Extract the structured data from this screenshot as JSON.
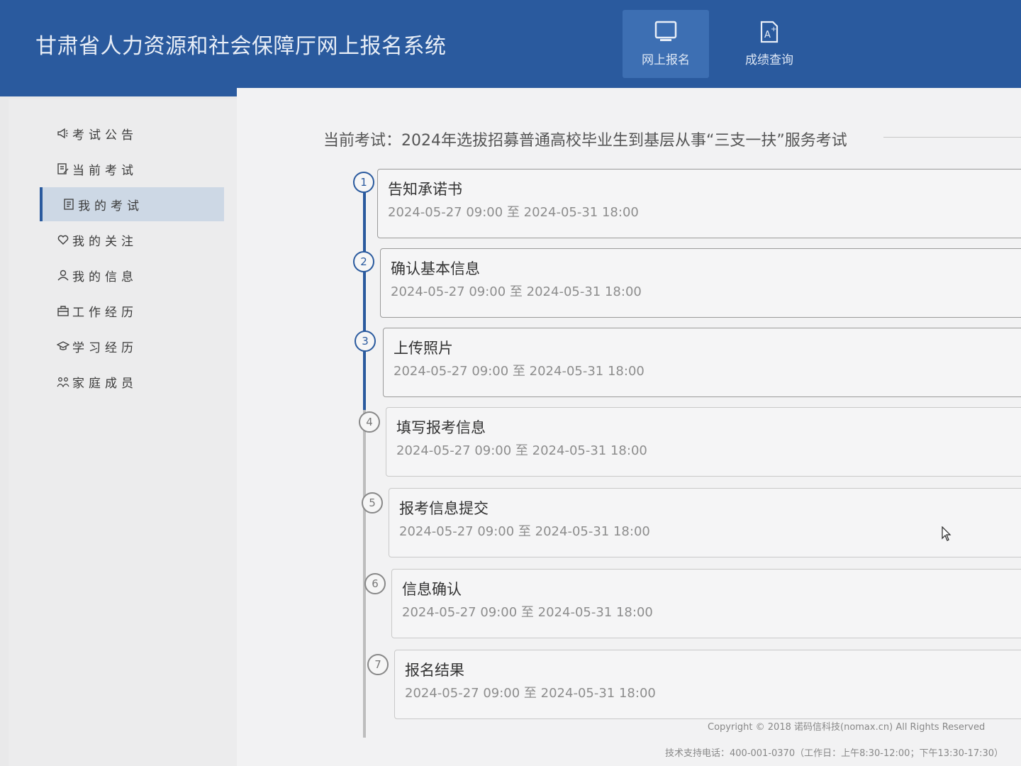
{
  "header": {
    "title": "甘肃省人力资源和社会保障厅网上报名系统",
    "nav": [
      {
        "label": "网上报名",
        "icon": "monitor-icon",
        "active": true
      },
      {
        "label": "成绩查询",
        "icon": "grade-doc-icon",
        "active": false
      }
    ]
  },
  "sidebar": {
    "items": [
      {
        "label": "考试公告",
        "icon": "megaphone-icon"
      },
      {
        "label": "当前考试",
        "icon": "edit-doc-icon"
      },
      {
        "label": "我的考试",
        "icon": "doc-list-icon",
        "active": true
      },
      {
        "label": "我的关注",
        "icon": "heart-icon"
      },
      {
        "label": "我的信息",
        "icon": "user-icon"
      },
      {
        "label": "工作经历",
        "icon": "briefcase-icon"
      },
      {
        "label": "学习经历",
        "icon": "graduation-cap-icon"
      },
      {
        "label": "家庭成员",
        "icon": "family-icon"
      }
    ]
  },
  "main": {
    "current_exam": "当前考试：2024年选拔招募普通高校毕业生到基层从事“三支一扶”服务考试",
    "steps": [
      {
        "num": "1",
        "name": "告知承诺书",
        "time": "2024-05-27 09:00 至 2024-05-31 18:00",
        "done": true
      },
      {
        "num": "2",
        "name": "确认基本信息",
        "time": "2024-05-27 09:00 至 2024-05-31 18:00",
        "done": true
      },
      {
        "num": "3",
        "name": "上传照片",
        "time": "2024-05-27 09:00 至 2024-05-31 18:00",
        "done": true
      },
      {
        "num": "4",
        "name": "填写报考信息",
        "time": "2024-05-27 09:00 至 2024-05-31 18:00",
        "done": false
      },
      {
        "num": "5",
        "name": "报考信息提交",
        "time": "2024-05-27 09:00 至 2024-05-31 18:00",
        "done": false
      },
      {
        "num": "6",
        "name": "信息确认",
        "time": "2024-05-27 09:00 至 2024-05-31 18:00",
        "done": false
      },
      {
        "num": "7",
        "name": "报名结果",
        "time": "2024-05-27 09:00 至 2024-05-31 18:00",
        "done": false
      }
    ]
  },
  "footer": {
    "copyright": "Copyright © 2018 诺码信科技(nomax.cn) All Rights Reserved",
    "support": "技术支持电话：400-001-0370（工作日：上午8:30-12:00；下午13:30-17:30）"
  },
  "colors": {
    "header_bg": "#2a5a9e",
    "accent": "#2a5a9e",
    "active_nav": "#3d6fb3"
  }
}
